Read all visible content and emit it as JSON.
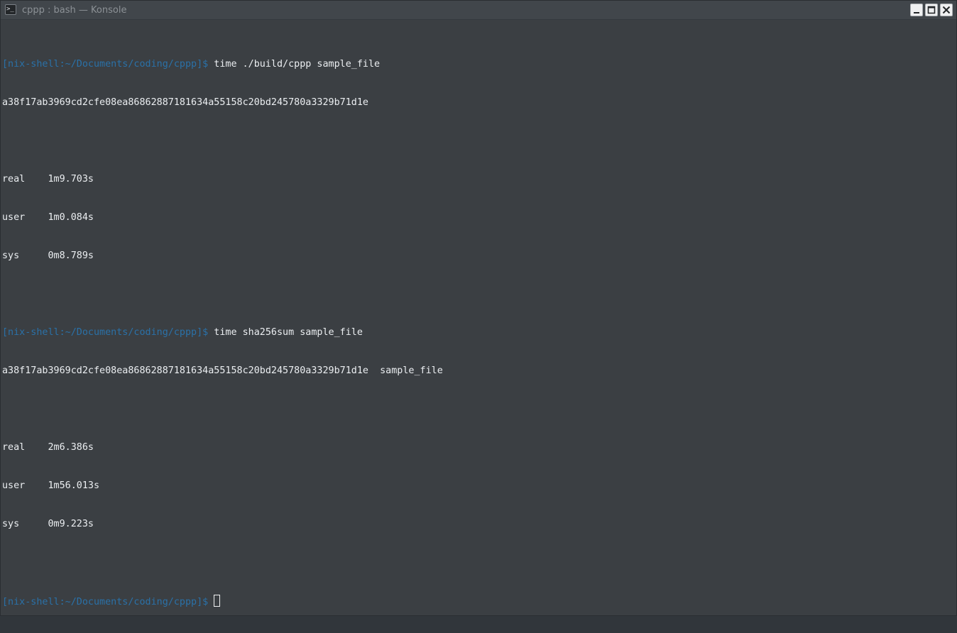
{
  "window": {
    "title": "cppp : bash — Konsole",
    "icon": "terminal-icon",
    "buttons": {
      "minimize": "minimize-icon",
      "maximize": "maximize-icon",
      "close": "close-icon"
    }
  },
  "colors": {
    "background": "#3b3f43",
    "text": "#ebeef1",
    "prompt": "#2a71a8"
  },
  "terminal": {
    "prompt": "[nix-shell:~/Documents/coding/cppp]$",
    "session1": {
      "command": " time ./build/cppp sample_file",
      "output": "a38f17ab3969cd2cfe08ea86862887181634a55158c20bd245780a3329b71d1e",
      "real": "real\t1m9.703s",
      "user": "user\t1m0.084s",
      "sys": "sys\t0m8.789s"
    },
    "session2": {
      "command": " time sha256sum sample_file",
      "output": "a38f17ab3969cd2cfe08ea86862887181634a55158c20bd245780a3329b71d1e  sample_file",
      "real": "real\t2m6.386s",
      "user": "user\t1m56.013s",
      "sys": "sys\t0m9.223s"
    },
    "current": {
      "input": " "
    }
  }
}
